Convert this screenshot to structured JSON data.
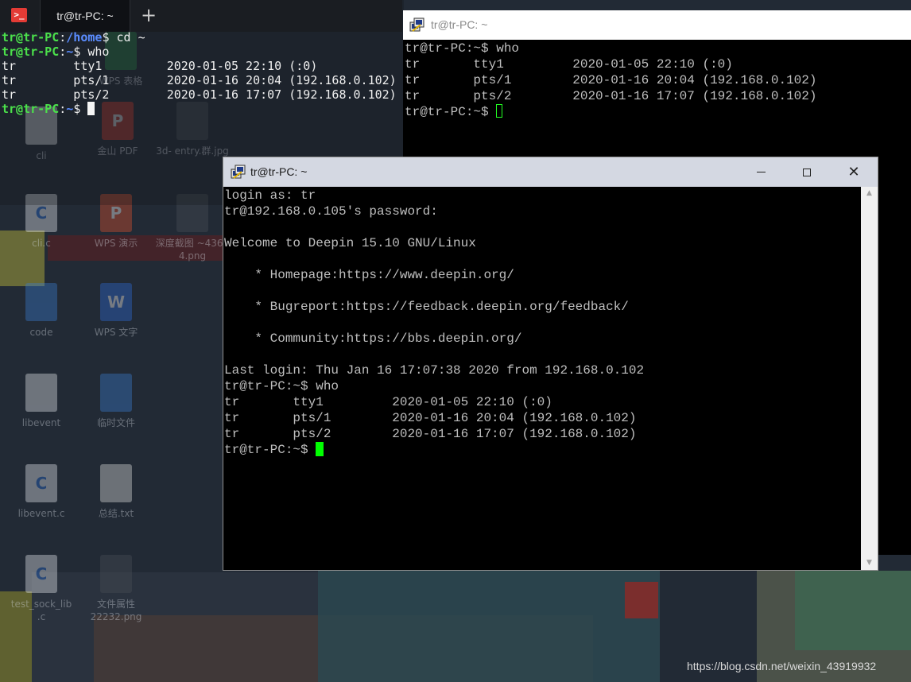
{
  "desktop": {
    "icons": [
      {
        "label": "WPS 表格",
        "glyph": "",
        "kind": "g-file"
      },
      {
        "label": "cli",
        "glyph": "",
        "kind": "g-file"
      },
      {
        "label": "金山 PDF",
        "glyph": "P",
        "kind": "g-wps-pdf"
      },
      {
        "label": "3d-\nentry.群.jpg",
        "glyph": "",
        "kind": "g-img"
      },
      {
        "label": "cli.c",
        "glyph": "C",
        "kind": "g-file"
      },
      {
        "label": "WPS 演示",
        "glyph": "P",
        "kind": "g-wps-p"
      },
      {
        "label": "深度截图\n~43604.png",
        "glyph": "",
        "kind": "g-img"
      },
      {
        "label": "code",
        "glyph": "",
        "kind": "g-folder"
      },
      {
        "label": "WPS 文字",
        "glyph": "W",
        "kind": "g-wps-w"
      },
      {
        "label": "libevent",
        "glyph": "",
        "kind": "g-file"
      },
      {
        "label": "临时文件",
        "glyph": "",
        "kind": "g-folder"
      },
      {
        "label": "libevent.c",
        "glyph": "C",
        "kind": "g-file"
      },
      {
        "label": "总结.txt",
        "glyph": "",
        "kind": "g-txt"
      },
      {
        "label": "test_sock_lib\n.c",
        "glyph": "C",
        "kind": "g-file"
      },
      {
        "label": "文件属性\n22232.png",
        "glyph": "",
        "kind": "g-img"
      }
    ],
    "watermark": "https://blog.csdn.net/weixin_43919932"
  },
  "deepin_terminal": {
    "app_icon": ">_",
    "tab_title": "tr@tr-PC: ~",
    "add_tab": "+",
    "lines": [
      [
        {
          "t": "tr@tr-PC",
          "c": "p-user"
        },
        {
          "t": ":",
          "c": ""
        },
        {
          "t": "/home",
          "c": "p-path"
        },
        {
          "t": "$ cd ~",
          "c": ""
        }
      ],
      [
        {
          "t": "tr@tr-PC",
          "c": "p-user"
        },
        {
          "t": ":",
          "c": ""
        },
        {
          "t": "~",
          "c": "p-path"
        },
        {
          "t": "$ who",
          "c": ""
        }
      ],
      [
        {
          "t": "tr        tty1         2020-01-05 22:10 (:0)",
          "c": ""
        }
      ],
      [
        {
          "t": "tr        pts/1        2020-01-16 20:04 (192.168.0.102)",
          "c": ""
        }
      ],
      [
        {
          "t": "tr        pts/2        2020-01-16 17:07 (192.168.0.102)",
          "c": ""
        }
      ],
      [
        {
          "t": "tr@tr-PC",
          "c": "p-user"
        },
        {
          "t": ":",
          "c": ""
        },
        {
          "t": "~",
          "c": "p-path"
        },
        {
          "t": "$ ",
          "c": ""
        }
      ]
    ]
  },
  "putty_back": {
    "title": "tr@tr-PC: ~",
    "lines": [
      "tr@tr-PC:~$ who",
      "tr       tty1         2020-01-05 22:10 (:0)",
      "tr       pts/1        2020-01-16 20:04 (192.168.0.102)",
      "tr       pts/2        2020-01-16 17:07 (192.168.0.102)",
      "tr@tr-PC:~$ "
    ]
  },
  "putty_front": {
    "title": "tr@tr-PC: ~",
    "min_label": "",
    "max_label": "",
    "close_label": "✕",
    "lines": [
      "login as: tr",
      "tr@192.168.0.105's password:",
      "",
      "Welcome to Deepin 15.10 GNU/Linux",
      "",
      "    * Homepage:https://www.deepin.org/",
      "",
      "    * Bugreport:https://feedback.deepin.org/feedback/",
      "",
      "    * Community:https://bbs.deepin.org/",
      "",
      "Last login: Thu Jan 16 17:07:38 2020 from 192.168.0.102",
      "tr@tr-PC:~$ who",
      "tr       tty1         2020-01-05 22:10 (:0)",
      "tr       pts/1        2020-01-16 20:04 (192.168.0.102)",
      "tr       pts/2        2020-01-16 17:07 (192.168.0.102)",
      "tr@tr-PC:~$ "
    ],
    "scroll_up": "▲",
    "scroll_down": "▼"
  }
}
